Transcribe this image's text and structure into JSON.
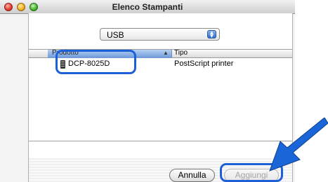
{
  "window": {
    "title": "Elenco Stampanti"
  },
  "connection": {
    "selected": "USB"
  },
  "list": {
    "columns": [
      "Prodotto",
      "Tipo"
    ],
    "rows": [
      {
        "product": "DCP-8025D",
        "type": "PostScript printer"
      }
    ]
  },
  "buttons": {
    "cancel": "Annulla",
    "add": "Aggiungi"
  },
  "colors": {
    "highlight": "#1d5fd6",
    "arrow": "#1a66d8"
  }
}
